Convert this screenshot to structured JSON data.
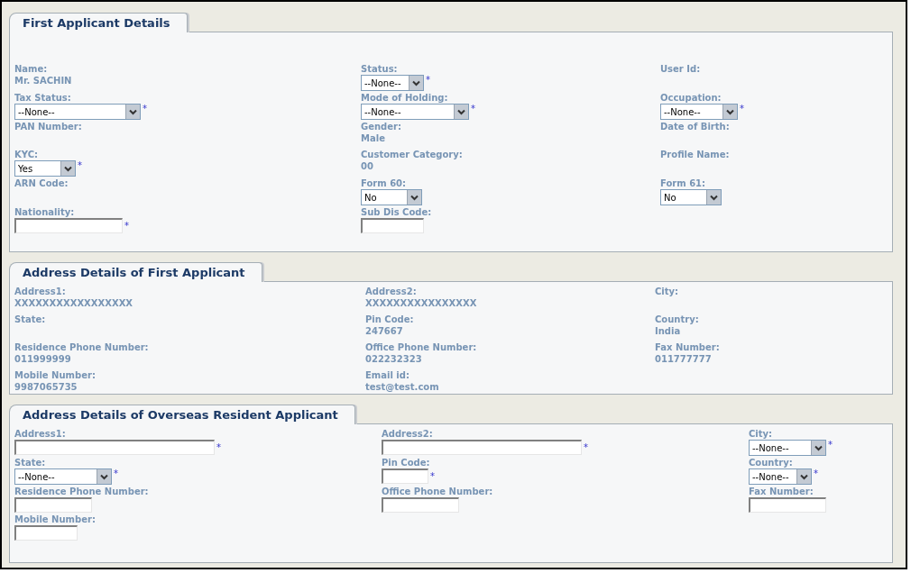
{
  "sections": [
    {
      "title": "First Applicant Details",
      "rows": [
        [
          {
            "kind": "text",
            "label": "Name:",
            "value": "Mr. SACHIN"
          },
          {
            "kind": "select",
            "label": "Status:",
            "value": "--None--",
            "mark": "*"
          },
          {
            "kind": "text",
            "label": "User Id:"
          }
        ],
        [
          {
            "kind": "select",
            "label": "Tax Status:",
            "value": "--None--",
            "mark": "*"
          },
          {
            "kind": "select",
            "label": "Mode of Holding:",
            "value": "--None--",
            "mark": "*"
          },
          {
            "kind": "select",
            "label": "Occupation:",
            "value": "--None--",
            "mark": "*"
          }
        ],
        [
          {
            "kind": "text",
            "label": "PAN Number:"
          },
          {
            "kind": "text",
            "label": "Gender:",
            "value": "Male"
          },
          {
            "kind": "text",
            "label": "Date of Birth:"
          }
        ],
        [
          {
            "kind": "select",
            "label": "KYC:",
            "value": "Yes",
            "mark": "*"
          },
          {
            "kind": "text",
            "label": "Customer Category:",
            "value": "00"
          },
          {
            "kind": "text",
            "label": "Profile Name:"
          }
        ],
        [
          {
            "kind": "text",
            "label": "ARN Code:"
          },
          {
            "kind": "select",
            "label": "Form 60:",
            "value": "No"
          },
          {
            "kind": "select",
            "label": "Form 61:",
            "value": "No"
          }
        ],
        [
          {
            "kind": "input",
            "label": "Nationality:",
            "mark": "*"
          },
          {
            "kind": "input",
            "label": "Sub Dis Code:"
          }
        ]
      ]
    },
    {
      "title": "Address Details of First Applicant",
      "rows": [
        [
          {
            "kind": "text",
            "label": "Address1:",
            "value": "XXXXXXXXXXXXXXXXX"
          },
          {
            "kind": "text",
            "label": "Address2:",
            "value": "XXXXXXXXXXXXXXXX"
          },
          {
            "kind": "text",
            "label": "City:"
          }
        ],
        [
          {
            "kind": "text",
            "label": "State:"
          },
          {
            "kind": "text",
            "label": "Pin Code:",
            "value": "247667"
          },
          {
            "kind": "text",
            "label": "Country:",
            "value": "India"
          }
        ],
        [
          {
            "kind": "text",
            "label": "Residence Phone Number:",
            "value": "011999999"
          },
          {
            "kind": "text",
            "label": "Office Phone Number:",
            "value": "022232323"
          },
          {
            "kind": "text",
            "label": "Fax Number:",
            "value": "011777777"
          }
        ],
        [
          {
            "kind": "text",
            "label": "Mobile Number:",
            "value": "9987065735"
          },
          {
            "kind": "text",
            "label": "Email id:",
            "value": "test@test.com"
          }
        ]
      ]
    },
    {
      "title": "Address Details of Overseas Resident Applicant",
      "rows": [
        [
          {
            "kind": "input",
            "label": "Address1:",
            "mark": "*"
          },
          {
            "kind": "input",
            "label": "Address2:",
            "mark": "*"
          },
          {
            "kind": "select",
            "label": "City:",
            "value": "--None--",
            "mark": "*"
          }
        ],
        [
          {
            "kind": "select",
            "label": "State:",
            "value": "--None--",
            "mark": "*"
          },
          {
            "kind": "input",
            "label": "Pin Code:",
            "mark": "*"
          },
          {
            "kind": "select",
            "label": "Country:",
            "value": "--None--",
            "mark": "*"
          }
        ],
        [
          {
            "kind": "input",
            "label": "Residence Phone Number:"
          },
          {
            "kind": "input",
            "label": "Office Phone Number:"
          },
          {
            "kind": "input",
            "label": "Fax Number:"
          }
        ],
        [
          {
            "kind": "input",
            "label": "Mobile Number:"
          }
        ]
      ]
    }
  ]
}
